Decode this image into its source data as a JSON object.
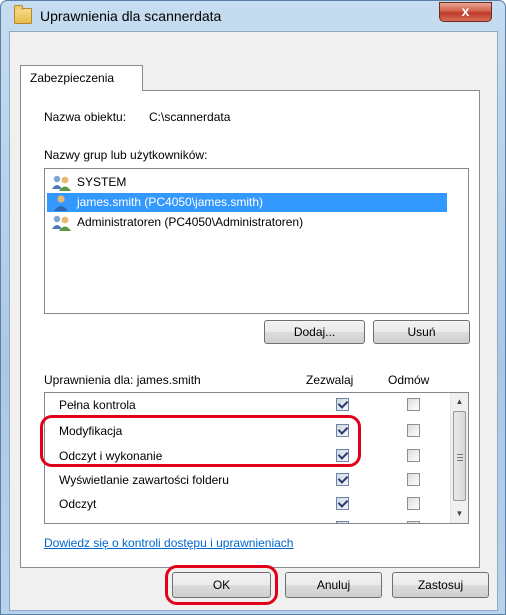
{
  "window": {
    "title": "Uprawnienia dla scannerdata",
    "close_label": "x"
  },
  "tabs": [
    {
      "label": "Zabezpieczenia"
    }
  ],
  "object_name": {
    "label": "Nazwa obiektu:",
    "value": "C:\\scannerdata"
  },
  "groups": {
    "label": "Nazwy grup lub użytkowników:",
    "items": [
      {
        "label": "SYSTEM",
        "icon": "group-icon",
        "selected": false
      },
      {
        "label": "james.smith (PC4050\\james.smith)",
        "icon": "user-icon",
        "selected": true
      },
      {
        "label": "Administratoren (PC4050\\Administratoren)",
        "icon": "group-icon",
        "selected": false
      }
    ],
    "add_label": "Dodaj...",
    "remove_label": "Usuń"
  },
  "permissions": {
    "label": "Uprawnienia dla: james.smith",
    "allow_header": "Zezwalaj",
    "deny_header": "Odmów",
    "rows": [
      {
        "name": "Pełna kontrola",
        "allow": true,
        "deny": false
      },
      {
        "name": "Modyfikacja",
        "allow": true,
        "deny": false
      },
      {
        "name": "Odczyt i wykonanie",
        "allow": true,
        "deny": false
      },
      {
        "name": "Wyświetlanie zawartości folderu",
        "allow": true,
        "deny": false
      },
      {
        "name": "Odczyt",
        "allow": true,
        "deny": false
      }
    ]
  },
  "help_link": "Dowiedz się o kontroli dostępu i uprawnieniach",
  "buttons": {
    "ok": "OK",
    "cancel": "Anuluj",
    "apply": "Zastosuj"
  },
  "colors": {
    "highlight": "#e0001a",
    "selection": "#3399ff",
    "link": "#0066cc"
  }
}
